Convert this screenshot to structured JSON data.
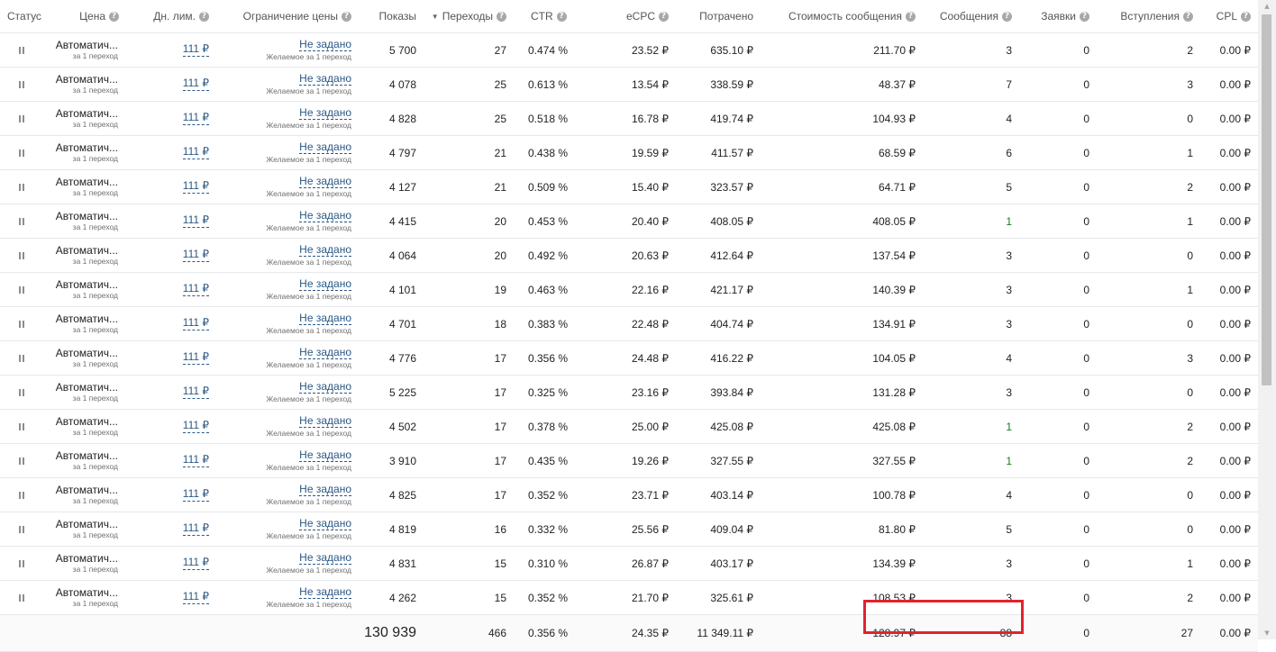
{
  "headers": {
    "status": "Статус",
    "price": "Цена",
    "daily_limit": "Дн. лим.",
    "price_limit": "Ограничение цены",
    "impressions": "Показы",
    "clicks": "Переходы",
    "ctr": "CTR",
    "ecpc": "eCPC",
    "spent": "Потрачено",
    "msg_cost": "Стоимость сообщения",
    "messages": "Сообщения",
    "requests": "Заявки",
    "joins": "Вступления",
    "cpl": "CPL"
  },
  "help_glyph": "?",
  "sort_glyph": "▼",
  "rows": [
    {
      "status_icon": "pause-icon",
      "price": "Автоматич...",
      "price_sub": "за 1 переход",
      "daily_limit": "111 ₽",
      "price_limit": "Не задано",
      "price_limit_sub": "Желаемое за 1 переход",
      "impressions": "5 700",
      "clicks": "27",
      "ctr": "0.474 %",
      "ecpc": "23.52 ₽",
      "spent": "635.10 ₽",
      "msg_cost": "211.70 ₽",
      "messages": "3",
      "requests": "0",
      "joins": "2",
      "cpl": "0.00 ₽"
    },
    {
      "status_icon": "pause-icon",
      "price": "Автоматич...",
      "price_sub": "за 1 переход",
      "daily_limit": "111 ₽",
      "price_limit": "Не задано",
      "price_limit_sub": "Желаемое за 1 переход",
      "impressions": "4 078",
      "clicks": "25",
      "ctr": "0.613 %",
      "ecpc": "13.54 ₽",
      "spent": "338.59 ₽",
      "msg_cost": "48.37 ₽",
      "messages": "7",
      "requests": "0",
      "joins": "3",
      "cpl": "0.00 ₽"
    },
    {
      "status_icon": "pause-icon",
      "price": "Автоматич...",
      "price_sub": "за 1 переход",
      "daily_limit": "111 ₽",
      "price_limit": "Не задано",
      "price_limit_sub": "Желаемое за 1 переход",
      "impressions": "4 828",
      "clicks": "25",
      "ctr": "0.518 %",
      "ecpc": "16.78 ₽",
      "spent": "419.74 ₽",
      "msg_cost": "104.93 ₽",
      "messages": "4",
      "requests": "0",
      "joins": "0",
      "cpl": "0.00 ₽"
    },
    {
      "status_icon": "pause-icon",
      "price": "Автоматич...",
      "price_sub": "за 1 переход",
      "daily_limit": "111 ₽",
      "price_limit": "Не задано",
      "price_limit_sub": "Желаемое за 1 переход",
      "impressions": "4 797",
      "clicks": "21",
      "ctr": "0.438 %",
      "ecpc": "19.59 ₽",
      "spent": "411.57 ₽",
      "msg_cost": "68.59 ₽",
      "messages": "6",
      "requests": "0",
      "joins": "1",
      "cpl": "0.00 ₽"
    },
    {
      "status_icon": "pause-icon",
      "price": "Автоматич...",
      "price_sub": "за 1 переход",
      "daily_limit": "111 ₽",
      "price_limit": "Не задано",
      "price_limit_sub": "Желаемое за 1 переход",
      "impressions": "4 127",
      "clicks": "21",
      "ctr": "0.509 %",
      "ecpc": "15.40 ₽",
      "spent": "323.57 ₽",
      "msg_cost": "64.71 ₽",
      "messages": "5",
      "requests": "0",
      "joins": "2",
      "cpl": "0.00 ₽"
    },
    {
      "status_icon": "pause-icon",
      "price": "Автоматич...",
      "price_sub": "за 1 переход",
      "daily_limit": "111 ₽",
      "price_limit": "Не задано",
      "price_limit_sub": "Желаемое за 1 переход",
      "impressions": "4 415",
      "clicks": "20",
      "ctr": "0.453 %",
      "ecpc": "20.40 ₽",
      "spent": "408.05 ₽",
      "msg_cost": "408.05 ₽",
      "messages": "1",
      "requests": "0",
      "joins": "1",
      "cpl": "0.00 ₽"
    },
    {
      "status_icon": "pause-icon",
      "price": "Автоматич...",
      "price_sub": "за 1 переход",
      "daily_limit": "111 ₽",
      "price_limit": "Не задано",
      "price_limit_sub": "Желаемое за 1 переход",
      "impressions": "4 064",
      "clicks": "20",
      "ctr": "0.492 %",
      "ecpc": "20.63 ₽",
      "spent": "412.64 ₽",
      "msg_cost": "137.54 ₽",
      "messages": "3",
      "requests": "0",
      "joins": "0",
      "cpl": "0.00 ₽"
    },
    {
      "status_icon": "pause-icon",
      "price": "Автоматич...",
      "price_sub": "за 1 переход",
      "daily_limit": "111 ₽",
      "price_limit": "Не задано",
      "price_limit_sub": "Желаемое за 1 переход",
      "impressions": "4 101",
      "clicks": "19",
      "ctr": "0.463 %",
      "ecpc": "22.16 ₽",
      "spent": "421.17 ₽",
      "msg_cost": "140.39 ₽",
      "messages": "3",
      "requests": "0",
      "joins": "1",
      "cpl": "0.00 ₽"
    },
    {
      "status_icon": "pause-icon",
      "price": "Автоматич...",
      "price_sub": "за 1 переход",
      "daily_limit": "111 ₽",
      "price_limit": "Не задано",
      "price_limit_sub": "Желаемое за 1 переход",
      "impressions": "4 701",
      "clicks": "18",
      "ctr": "0.383 %",
      "ecpc": "22.48 ₽",
      "spent": "404.74 ₽",
      "msg_cost": "134.91 ₽",
      "messages": "3",
      "requests": "0",
      "joins": "0",
      "cpl": "0.00 ₽"
    },
    {
      "status_icon": "pause-icon",
      "price": "Автоматич...",
      "price_sub": "за 1 переход",
      "daily_limit": "111 ₽",
      "price_limit": "Не задано",
      "price_limit_sub": "Желаемое за 1 переход",
      "impressions": "4 776",
      "clicks": "17",
      "ctr": "0.356 %",
      "ecpc": "24.48 ₽",
      "spent": "416.22 ₽",
      "msg_cost": "104.05 ₽",
      "messages": "4",
      "requests": "0",
      "joins": "3",
      "cpl": "0.00 ₽"
    },
    {
      "status_icon": "pause-icon",
      "price": "Автоматич...",
      "price_sub": "за 1 переход",
      "daily_limit": "111 ₽",
      "price_limit": "Не задано",
      "price_limit_sub": "Желаемое за 1 переход",
      "impressions": "5 225",
      "clicks": "17",
      "ctr": "0.325 %",
      "ecpc": "23.16 ₽",
      "spent": "393.84 ₽",
      "msg_cost": "131.28 ₽",
      "messages": "3",
      "requests": "0",
      "joins": "0",
      "cpl": "0.00 ₽"
    },
    {
      "status_icon": "pause-icon",
      "price": "Автоматич...",
      "price_sub": "за 1 переход",
      "daily_limit": "111 ₽",
      "price_limit": "Не задано",
      "price_limit_sub": "Желаемое за 1 переход",
      "impressions": "4 502",
      "clicks": "17",
      "ctr": "0.378 %",
      "ecpc": "25.00 ₽",
      "spent": "425.08 ₽",
      "msg_cost": "425.08 ₽",
      "messages": "1",
      "requests": "0",
      "joins": "2",
      "cpl": "0.00 ₽"
    },
    {
      "status_icon": "pause-icon",
      "price": "Автоматич...",
      "price_sub": "за 1 переход",
      "daily_limit": "111 ₽",
      "price_limit": "Не задано",
      "price_limit_sub": "Желаемое за 1 переход",
      "impressions": "3 910",
      "clicks": "17",
      "ctr": "0.435 %",
      "ecpc": "19.26 ₽",
      "spent": "327.55 ₽",
      "msg_cost": "327.55 ₽",
      "messages": "1",
      "requests": "0",
      "joins": "2",
      "cpl": "0.00 ₽"
    },
    {
      "status_icon": "pause-icon",
      "price": "Автоматич...",
      "price_sub": "за 1 переход",
      "daily_limit": "111 ₽",
      "price_limit": "Не задано",
      "price_limit_sub": "Желаемое за 1 переход",
      "impressions": "4 825",
      "clicks": "17",
      "ctr": "0.352 %",
      "ecpc": "23.71 ₽",
      "spent": "403.14 ₽",
      "msg_cost": "100.78 ₽",
      "messages": "4",
      "requests": "0",
      "joins": "0",
      "cpl": "0.00 ₽"
    },
    {
      "status_icon": "pause-icon",
      "price": "Автоматич...",
      "price_sub": "за 1 переход",
      "daily_limit": "111 ₽",
      "price_limit": "Не задано",
      "price_limit_sub": "Желаемое за 1 переход",
      "impressions": "4 819",
      "clicks": "16",
      "ctr": "0.332 %",
      "ecpc": "25.56 ₽",
      "spent": "409.04 ₽",
      "msg_cost": "81.80 ₽",
      "messages": "5",
      "requests": "0",
      "joins": "0",
      "cpl": "0.00 ₽"
    },
    {
      "status_icon": "pause-icon",
      "price": "Автоматич...",
      "price_sub": "за 1 переход",
      "daily_limit": "111 ₽",
      "price_limit": "Не задано",
      "price_limit_sub": "Желаемое за 1 переход",
      "impressions": "4 831",
      "clicks": "15",
      "ctr": "0.310 %",
      "ecpc": "26.87 ₽",
      "spent": "403.17 ₽",
      "msg_cost": "134.39 ₽",
      "messages": "3",
      "requests": "0",
      "joins": "1",
      "cpl": "0.00 ₽"
    },
    {
      "status_icon": "pause-icon",
      "price": "Автоматич...",
      "price_sub": "за 1 переход",
      "daily_limit": "111 ₽",
      "price_limit": "Не задано",
      "price_limit_sub": "Желаемое за 1 переход",
      "impressions": "4 262",
      "clicks": "15",
      "ctr": "0.352 %",
      "ecpc": "21.70 ₽",
      "spent": "325.61 ₽",
      "msg_cost": "108.53 ₽",
      "messages": "3",
      "requests": "0",
      "joins": "2",
      "cpl": "0.00 ₽"
    }
  ],
  "totals": {
    "impressions": "130 939",
    "clicks": "466",
    "ctr": "0.356 %",
    "ecpc": "24.35 ₽",
    "spent": "11 349.11 ₽",
    "msg_cost": "128.97 ₽",
    "messages": "88",
    "requests": "0",
    "joins": "27",
    "cpl": "0.00 ₽"
  },
  "colors": {
    "link": "#2a5885",
    "highlight": "#e0232c",
    "single_message": "#0f7d20"
  },
  "scroll_up_glyph": "▲",
  "scroll_down_glyph": "▼"
}
